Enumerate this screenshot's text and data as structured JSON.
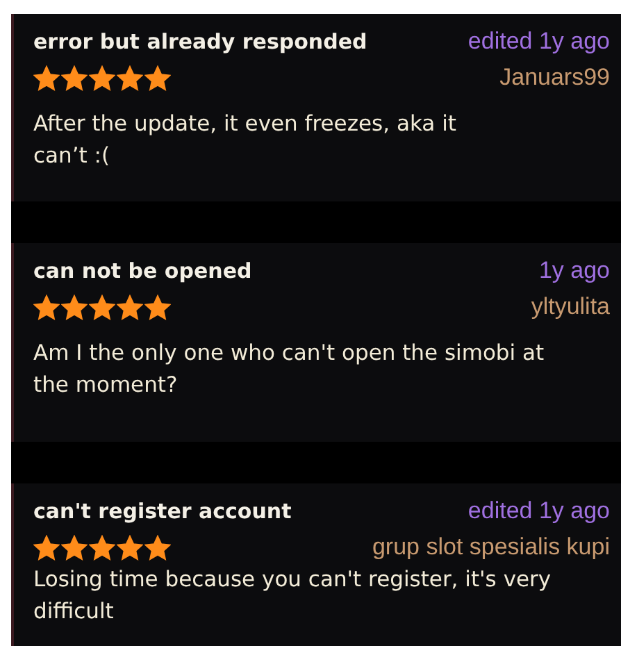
{
  "reviews": [
    {
      "title": "error but already responded",
      "time": "edited 1y ago",
      "author": "Januars99",
      "stars": 5,
      "body": "After the update, it even freezes, aka it can’t :("
    },
    {
      "title": "can not be opened",
      "time": "1y ago",
      "author": "yltyulita",
      "stars": 5,
      "body": "Am I the only one who can't open the simobi at the moment?"
    },
    {
      "title": "can't register account",
      "time": "edited 1y ago",
      "author": "grup slot spesialis kupi",
      "stars": 5,
      "body": "Losing time because you can't register, it's very difficult"
    }
  ]
}
